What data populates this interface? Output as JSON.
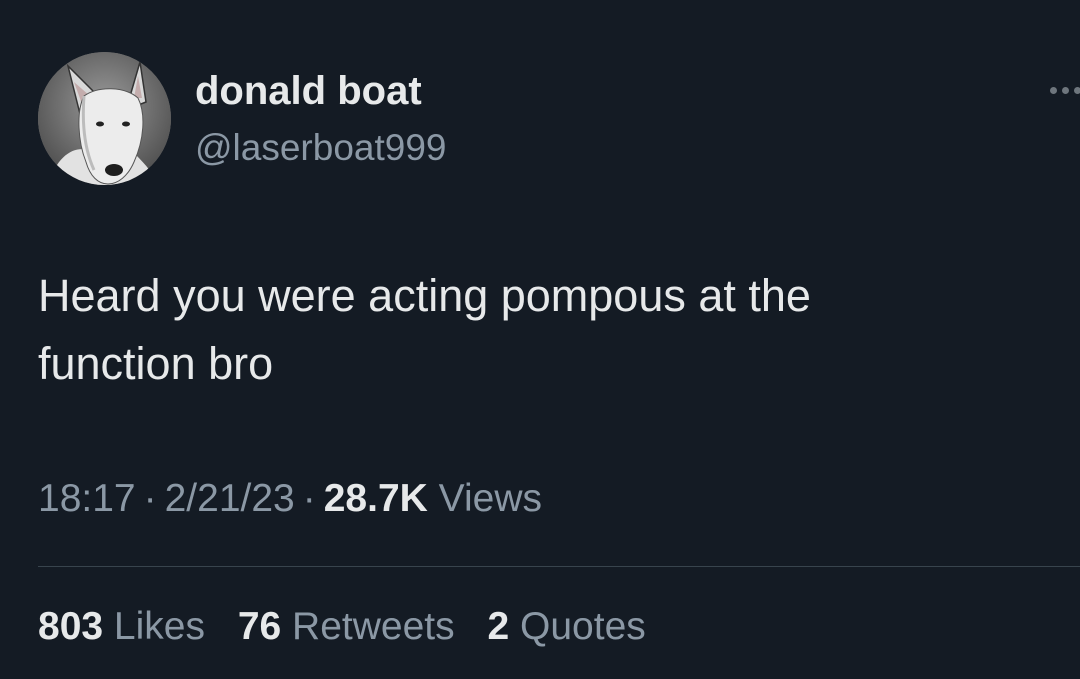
{
  "author": {
    "display_name": "donald boat",
    "handle": "@laserboat999",
    "avatar_icon": "bull-terrier-avatar"
  },
  "tweet": {
    "lines": [
      "Heard you were acting pompous at the",
      "function bro"
    ]
  },
  "meta": {
    "time": "18:17",
    "separator": "·",
    "date": "2/21/23",
    "views_count": "28.7K",
    "views_label": "Views"
  },
  "stats": {
    "likes_count": "803",
    "likes_label": "Likes",
    "retweets_count": "76",
    "retweets_label": "Retweets",
    "quotes_count": "2",
    "quotes_label": "Quotes"
  },
  "colors": {
    "background": "#141b24",
    "primary_text": "#e7e9ea",
    "secondary_text": "#8b98a5",
    "divider": "#38444d"
  },
  "icons": {
    "more": "more-dots-icon"
  }
}
